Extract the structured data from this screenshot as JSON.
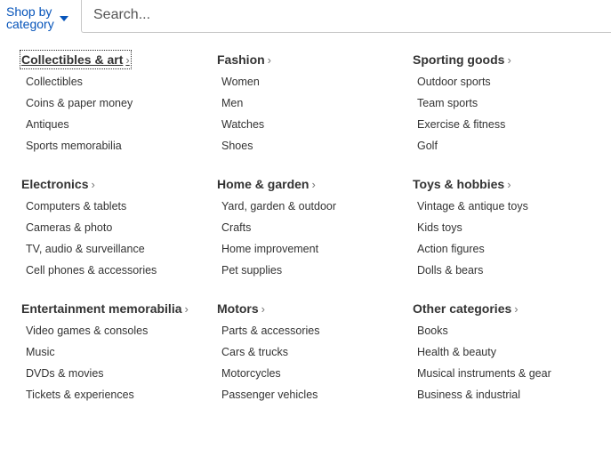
{
  "header": {
    "shop_line1": "Shop by",
    "shop_line2": "category",
    "search_placeholder": "Search..."
  },
  "columns": [
    {
      "groups": [
        {
          "title": "Collectibles & art",
          "items": [
            "Collectibles",
            "Coins & paper money",
            "Antiques",
            "Sports memorabilia"
          ]
        },
        {
          "title": "Electronics",
          "items": [
            "Computers & tablets",
            "Cameras & photo",
            "TV, audio & surveillance",
            "Cell phones & accessories"
          ]
        },
        {
          "title": "Entertainment memorabilia",
          "items": [
            "Video games & consoles",
            "Music",
            "DVDs & movies",
            "Tickets & experiences"
          ]
        }
      ]
    },
    {
      "groups": [
        {
          "title": "Fashion",
          "items": [
            "Women",
            "Men",
            "Watches",
            "Shoes"
          ]
        },
        {
          "title": "Home & garden",
          "items": [
            "Yard, garden & outdoor",
            "Crafts",
            "Home improvement",
            "Pet supplies"
          ]
        },
        {
          "title": "Motors",
          "items": [
            "Parts & accessories",
            "Cars & trucks",
            "Motorcycles",
            "Passenger vehicles"
          ]
        }
      ]
    },
    {
      "groups": [
        {
          "title": "Sporting goods",
          "items": [
            "Outdoor sports",
            "Team sports",
            "Exercise & fitness",
            "Golf"
          ]
        },
        {
          "title": "Toys & hobbies",
          "items": [
            "Vintage & antique toys",
            "Kids toys",
            "Action figures",
            "Dolls & bears"
          ]
        },
        {
          "title": "Other categories",
          "items": [
            "Books",
            "Health & beauty",
            "Musical instruments & gear",
            "Business & industrial"
          ]
        }
      ]
    }
  ],
  "icons": {
    "chevron": "›",
    "dropdown": "caret-down-icon",
    "chevron_name": "chevron-right-icon"
  },
  "colors": {
    "link_blue": "#0654ba",
    "text": "#333333",
    "border": "#c7c7c7"
  }
}
